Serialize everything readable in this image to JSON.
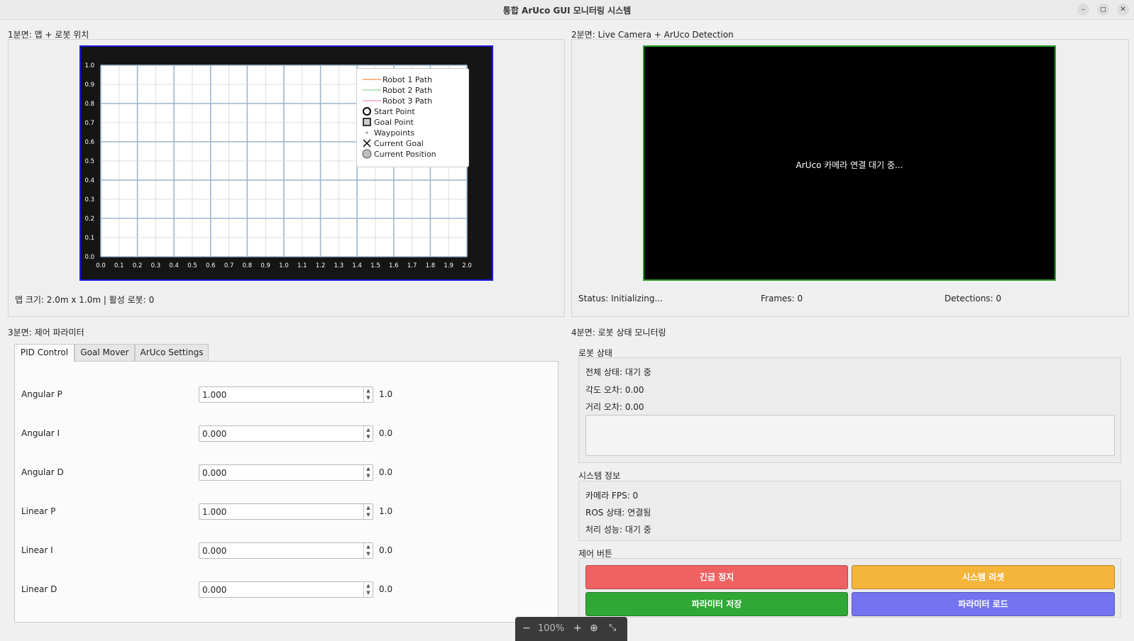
{
  "window": {
    "title": "통합 ArUco GUI 모니터링 시스템",
    "buttons": [
      "–",
      "◻",
      "✕"
    ]
  },
  "panel1": {
    "label": "1분면: 맵 + 로봇 위치",
    "status": "맵 크기: 2.0m x 1.0m | 활성 로봇: 0",
    "plot": {
      "x_ticks": [
        "0.0",
        "0.1",
        "0.2",
        "0.3",
        "0.4",
        "0.5",
        "0.6",
        "0.7",
        "0.8",
        "0.9",
        "1.0",
        "1.1",
        "1.2",
        "1.3",
        "1.4",
        "1.5",
        "1.6",
        "1.7",
        "1.8",
        "1.9",
        "2.0"
      ],
      "y_ticks": [
        "0.0",
        "0.1",
        "0.2",
        "0.3",
        "0.4",
        "0.5",
        "0.6",
        "0.7",
        "0.8",
        "0.9",
        "1.0"
      ],
      "legend": {
        "robot1": "Robot 1 Path",
        "robot2": "Robot 2 Path",
        "robot3": "Robot 3 Path",
        "start": "Start Point",
        "goal": "Goal Point",
        "waypoints": "Waypoints",
        "current_goal": "Current Goal",
        "current_position": "Current Position"
      },
      "colors": {
        "robot1": "#f5a064",
        "robot2": "#a6dca6",
        "robot3": "#f0a8b4",
        "grid_major": "#9ab6cf",
        "grid_minor": "#d4d4d4"
      }
    }
  },
  "panel2": {
    "label": "2분면: Live Camera + ArUco Detection",
    "camera_message": "ArUco 카메라 연결 대기 중...",
    "status": "Status: Initializing...",
    "frames": "Frames: 0",
    "detections": "Detections: 0"
  },
  "panel3": {
    "label": "3분면: 제어 파라미터",
    "tabs": [
      "PID Control",
      "Goal Mover",
      "ArUco Settings"
    ],
    "params": [
      {
        "label": "Angular P",
        "value": "1.000",
        "display": "1.0"
      },
      {
        "label": "Angular I",
        "value": "0.000",
        "display": "0.0"
      },
      {
        "label": "Angular D",
        "value": "0.000",
        "display": "0.0"
      },
      {
        "label": "Linear P",
        "value": "1.000",
        "display": "1.0"
      },
      {
        "label": "Linear I",
        "value": "0.000",
        "display": "0.0"
      },
      {
        "label": "Linear D",
        "value": "0.000",
        "display": "0.0"
      }
    ]
  },
  "panel4": {
    "label": "4분면: 로봇 상태 모니터링",
    "robot_status": {
      "title": "로봇 상태",
      "overall": "전체 상태: 대기 중",
      "angle_error": "각도 오차: 0.00",
      "distance_error": "거리 오차: 0.00"
    },
    "system_info": {
      "title": "시스템 정보",
      "camera_fps": "카메라 FPS: 0",
      "ros_status": "ROS 상태: 연결됨",
      "performance": "처리 성능: 대기 중"
    },
    "control": {
      "title": "제어 버튼",
      "estop": "긴급 정지",
      "reset": "시스템 리셋",
      "save": "파라미터 저장",
      "load": "파라미터 로드",
      "colors": {
        "estop": "#f06262",
        "reset": "#f5b43a",
        "save": "#2fa836",
        "load": "#7474f0"
      }
    }
  },
  "zoom": {
    "minus": "−",
    "level": "100%",
    "plus": "+"
  }
}
